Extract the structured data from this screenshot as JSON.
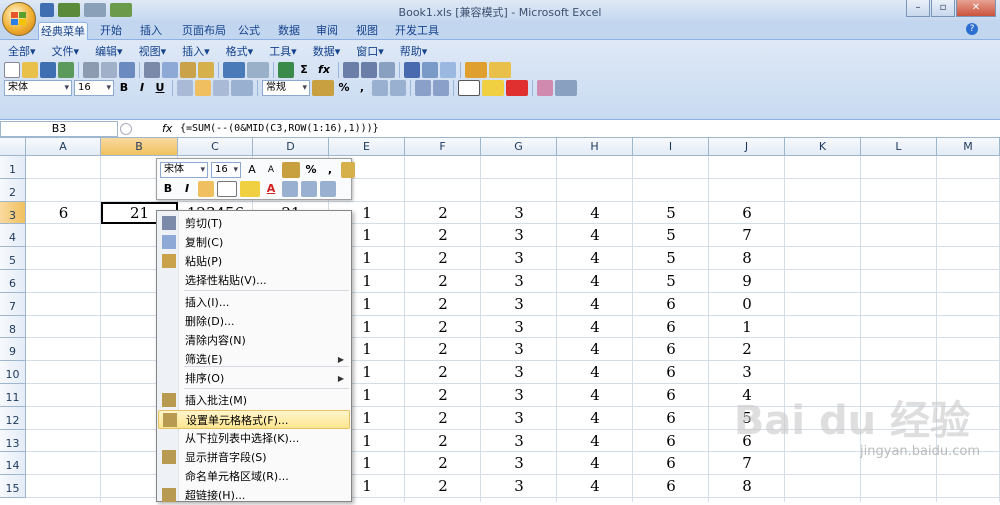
{
  "window": {
    "title": "Book1.xls  [兼容模式] - Microsoft Excel",
    "min": "–",
    "max": "▫",
    "close": "✕"
  },
  "ribbon_tabs": [
    "经典菜单",
    "开始",
    "插入",
    "页面布局",
    "公式",
    "数据",
    "审阅",
    "视图",
    "开发工具"
  ],
  "classic_menu": [
    "全部▾",
    "文件▾",
    "编辑▾",
    "视图▾",
    "插入▾",
    "格式▾",
    "工具▾",
    "数据▾",
    "窗口▾",
    "帮助▾"
  ],
  "toolbar": {
    "font": "宋体",
    "size": "16",
    "number_format": "常规",
    "bold": "B",
    "italic": "I",
    "underline": "U",
    "percent": "%",
    "comma": ",",
    "sigma": "Σ",
    "fx": "fx"
  },
  "formula_bar": {
    "name_box": "B3",
    "fx": "fx",
    "formula": "{=SUM(--(0&MID(C3,ROW(1:16),1)))}"
  },
  "columns": [
    "A",
    "B",
    "C",
    "D",
    "E",
    "F",
    "G",
    "H",
    "I",
    "J",
    "K",
    "L",
    "M"
  ],
  "rows": [
    "1",
    "2",
    "3",
    "4",
    "5",
    "6",
    "7",
    "8",
    "9",
    "10",
    "11",
    "12",
    "13",
    "14",
    "15"
  ],
  "cells": {
    "A3": "6",
    "B3": "21",
    "C3": "123456",
    "D3": "21"
  },
  "col_E": [
    "1",
    "1",
    "1",
    "1",
    "1",
    "1",
    "1",
    "1",
    "1",
    "1",
    "1",
    "1",
    "1"
  ],
  "col_F": [
    "2",
    "2",
    "2",
    "2",
    "2",
    "2",
    "2",
    "2",
    "2",
    "2",
    "2",
    "2",
    "2"
  ],
  "col_G": [
    "3",
    "3",
    "3",
    "3",
    "3",
    "3",
    "3",
    "3",
    "3",
    "3",
    "3",
    "3",
    "3"
  ],
  "col_H": [
    "4",
    "4",
    "4",
    "4",
    "4",
    "4",
    "4",
    "4",
    "4",
    "4",
    "4",
    "4",
    "4"
  ],
  "col_I": [
    "5",
    "5",
    "5",
    "5",
    "6",
    "6",
    "6",
    "6",
    "6",
    "6",
    "6",
    "6",
    "6"
  ],
  "col_J": [
    "6",
    "7",
    "8",
    "9",
    "0",
    "1",
    "2",
    "3",
    "4",
    "5",
    "6",
    "7",
    "8"
  ],
  "mini_toolbar": {
    "font": "宋体",
    "size": "16",
    "grow": "A",
    "shrink": "A",
    "percent": "%",
    "comma": ",",
    "bold": "B",
    "italic": "I",
    "font_color": "A"
  },
  "context_menu": [
    {
      "label": "剪切(T)",
      "icon": "cut-icon"
    },
    {
      "label": "复制(C)",
      "icon": "copy-icon"
    },
    {
      "label": "粘贴(P)",
      "icon": "paste-icon"
    },
    {
      "label": "选择性粘贴(V)...",
      "icon": ""
    },
    {
      "label": "插入(I)...",
      "icon": ""
    },
    {
      "label": "删除(D)...",
      "icon": ""
    },
    {
      "label": "清除内容(N)",
      "icon": ""
    },
    {
      "label": "筛选(E)",
      "icon": "",
      "arrow": "▶"
    },
    {
      "label": "排序(O)",
      "icon": "",
      "arrow": "▶"
    },
    {
      "label": "插入批注(M)",
      "icon": "comment-icon"
    },
    {
      "label": "设置单元格格式(F)...",
      "icon": "format-cells-icon"
    },
    {
      "label": "从下拉列表中选择(K)...",
      "icon": ""
    },
    {
      "label": "显示拼音字段(S)",
      "icon": "phonetic-icon"
    },
    {
      "label": "命名单元格区域(R)...",
      "icon": ""
    },
    {
      "label": "超链接(H)...",
      "icon": "hyperlink-icon"
    }
  ],
  "watermark": {
    "brand": "Bai du 经验",
    "url": "jingyan.baidu.com"
  }
}
